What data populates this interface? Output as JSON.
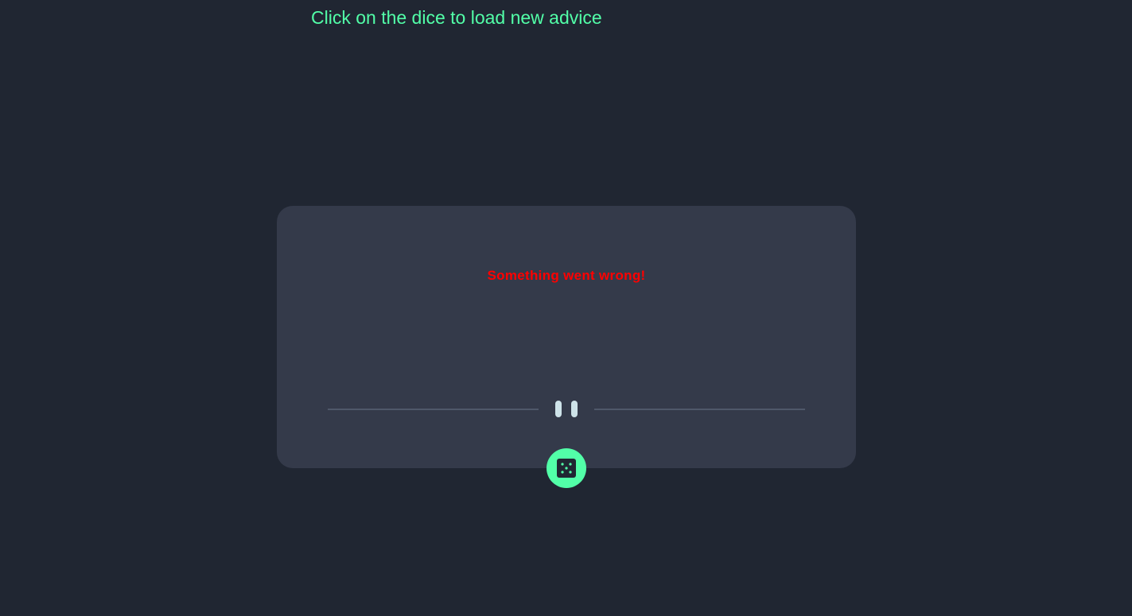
{
  "hint": {
    "text": "Click on the dice to load new advice"
  },
  "card": {
    "error_message": "Something went wrong!",
    "divider_icon": "pause-icon",
    "dice_icon": "dice-five-icon"
  },
  "colors": {
    "background": "#202632",
    "card": "#343a4a",
    "accent": "#52ffa8",
    "error": "#ff0000",
    "divider": "#4f5869",
    "quote_icon": "#cee3e9"
  }
}
